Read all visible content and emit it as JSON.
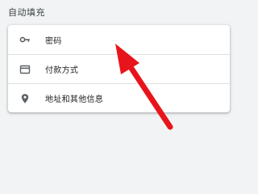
{
  "section": {
    "title": "自动填充"
  },
  "autofill_items": [
    {
      "label": "密码",
      "icon": "key-icon"
    },
    {
      "label": "付款方式",
      "icon": "credit-card-icon"
    },
    {
      "label": "地址和其他信息",
      "icon": "location-pin-icon"
    }
  ],
  "annotation": {
    "icon": "red-arrow-icon",
    "color": "#e8141b"
  }
}
